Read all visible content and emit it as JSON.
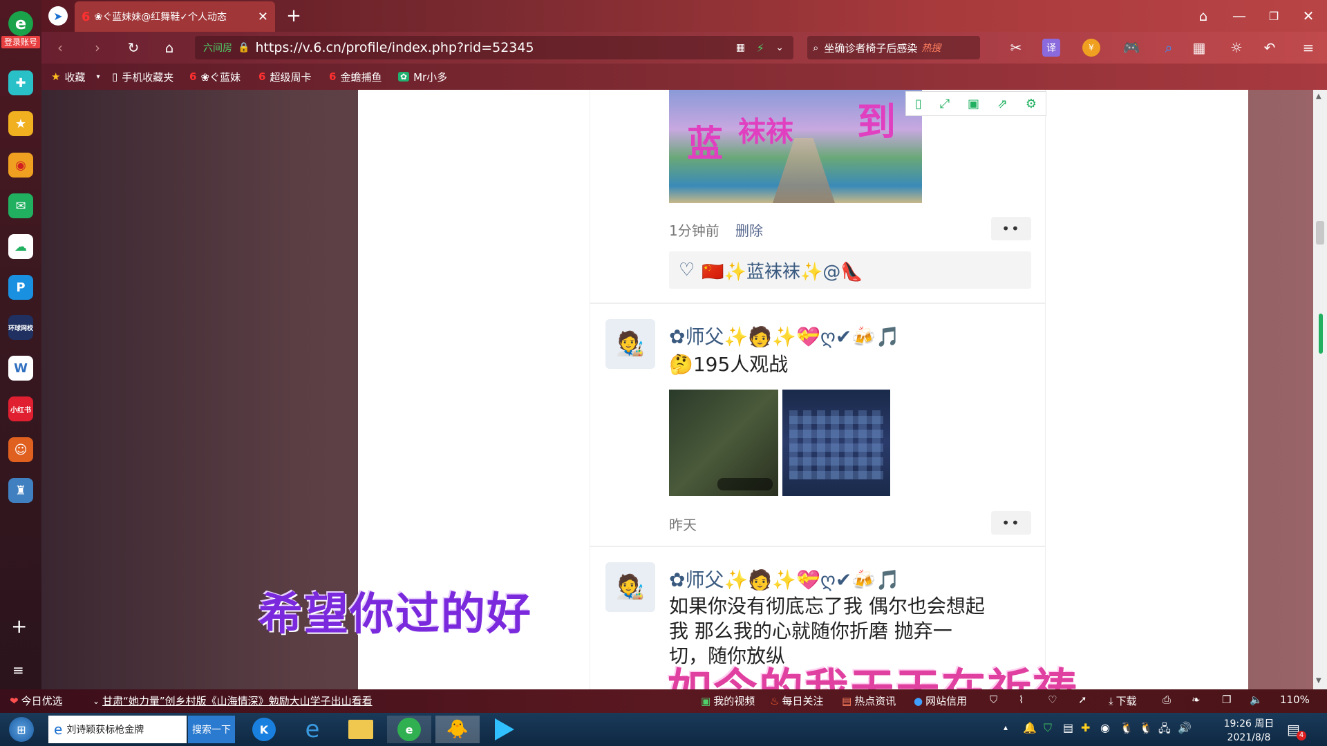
{
  "browser": {
    "tab_title": "❀ぐ蓝妹妹@红舞鞋✓个人动态",
    "new_tab": "+",
    "url": "https://v.6.cn/profile/index.php?rid=52345",
    "url_prefix": "六间房",
    "search_text": "坐确诊者椅子后感染",
    "search_hot": "热搜",
    "login_label": "登录账号",
    "translate_label": "译"
  },
  "bookmarks": [
    {
      "label": "收藏",
      "icon": "star-icon"
    },
    {
      "label": "手机收藏夹",
      "icon": "phone-icon"
    },
    {
      "label": "❀ぐ蓝妹",
      "icon": "six-icon"
    },
    {
      "label": "超级周卡",
      "icon": "six-icon"
    },
    {
      "label": "金蟾捕鱼",
      "icon": "six-icon"
    },
    {
      "label": "Mr小多",
      "icon": "app-icon"
    }
  ],
  "sidebar": {
    "items": [
      "paw-icon",
      "star-icon",
      "weibo-icon",
      "mail-icon",
      "cloud-icon",
      "p-icon",
      "news-icon",
      "doc-icon",
      "xiaohongshu-icon",
      "game-icon",
      "castle-icon"
    ],
    "news_label": "环球网校",
    "xhs_label": "小红书"
  },
  "feed": {
    "post1": {
      "image_text_1": "蓝",
      "image_text_2": "袜袜",
      "image_text_3": "到",
      "time": "1分钟前",
      "delete": "删除",
      "more": "••",
      "like_names": "🇨🇳✨蓝袜袜✨@👠"
    },
    "post2": {
      "username": "✿师父✨🧑✨💝ღ✔🍻🎵",
      "text": "🤔195人观战",
      "time": "昨天",
      "more": "••"
    },
    "post3": {
      "username": "✿师父✨🧑✨💝ღ✔🍻🎵",
      "text_line1": "如果你没有彻底忘了我 偶尔也会想起",
      "text_line2": "我 那么我的心就随你折磨 抛弃一",
      "text_line3": "切，随你放纵"
    }
  },
  "captions": {
    "left": "希望你过的好",
    "right": "如今的我天天在祈祷"
  },
  "status_bar": {
    "today": "今日优选",
    "news": "甘肃“她力量”创乡村版《山海情深》勉励大山学子出山看看",
    "my_video": "我的视频",
    "daily": "每日关注",
    "hot_news": "热点资讯",
    "site_credit": "网站信用",
    "download": "下载",
    "zoom": "110%"
  },
  "taskbar": {
    "search_text": "刘诗颖获标枪金牌",
    "search_button": "搜索一下",
    "time": "19:26 周日",
    "date": "2021/8/8",
    "notification_count": "4"
  }
}
